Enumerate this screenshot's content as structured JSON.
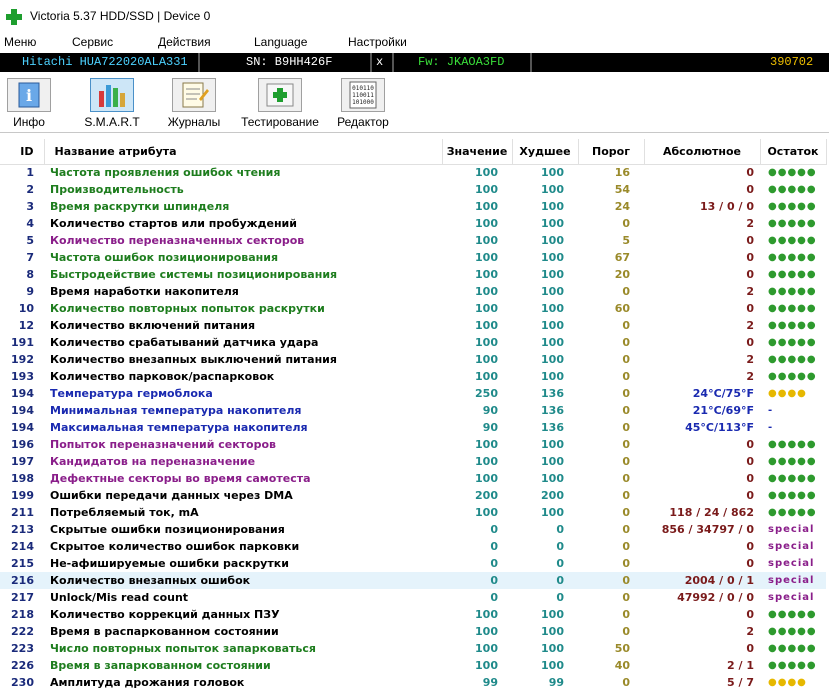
{
  "window": {
    "title": "Victoria 5.37 HDD/SSD | Device 0"
  },
  "menu": [
    "Меню",
    "Сервис",
    "Действия",
    "Language",
    "Настройки"
  ],
  "device": {
    "model": "Hitachi HUA722020ALA331",
    "sn": "SN: B9HH426F",
    "close": "x",
    "fw": "Fw: JKAOA3FD",
    "capacity": "390702"
  },
  "toolbar": [
    "Инфо",
    "S.M.A.R.T",
    "Журналы",
    "Тестирование",
    "Редактор"
  ],
  "table": {
    "headers": [
      "ID",
      "Название атрибута",
      "Значение",
      "Худшее",
      "Порог",
      "Абсолютное",
      "Остаток"
    ],
    "rows": [
      {
        "id": "1",
        "name": "Частота проявления ошибок чтения",
        "value": "100",
        "worst": "100",
        "threshold": "16",
        "abs": "0",
        "rem": "●●●●●",
        "color": "green",
        "absColor": "dark",
        "remColor": "green"
      },
      {
        "id": "2",
        "name": "Производительность",
        "value": "100",
        "worst": "100",
        "threshold": "54",
        "abs": "0",
        "rem": "●●●●●",
        "color": "green",
        "absColor": "dark",
        "remColor": "green"
      },
      {
        "id": "3",
        "name": "Время раскрутки шпинделя",
        "value": "100",
        "worst": "100",
        "threshold": "24",
        "abs": "13 / 0 / 0",
        "rem": "●●●●●",
        "color": "green",
        "absColor": "dark",
        "remColor": "green"
      },
      {
        "id": "4",
        "name": "Количество стартов или пробуждений",
        "value": "100",
        "worst": "100",
        "threshold": "0",
        "abs": "2",
        "rem": "●●●●●",
        "color": "black",
        "absColor": "dark",
        "remColor": "green"
      },
      {
        "id": "5",
        "name": "Количество переназначенных секторов",
        "value": "100",
        "worst": "100",
        "threshold": "5",
        "abs": "0",
        "rem": "●●●●●",
        "color": "purple",
        "absColor": "dark",
        "remColor": "green"
      },
      {
        "id": "7",
        "name": "Частота ошибок позиционирования",
        "value": "100",
        "worst": "100",
        "threshold": "67",
        "abs": "0",
        "rem": "●●●●●",
        "color": "green",
        "absColor": "dark",
        "remColor": "green"
      },
      {
        "id": "8",
        "name": "Быстродействие системы позиционирования",
        "value": "100",
        "worst": "100",
        "threshold": "20",
        "abs": "0",
        "rem": "●●●●●",
        "color": "green",
        "absColor": "dark",
        "remColor": "green"
      },
      {
        "id": "9",
        "name": "Время наработки накопителя",
        "value": "100",
        "worst": "100",
        "threshold": "0",
        "abs": "2",
        "rem": "●●●●●",
        "color": "black",
        "absColor": "dark",
        "remColor": "green"
      },
      {
        "id": "10",
        "name": "Количество повторных попыток раскрутки",
        "value": "100",
        "worst": "100",
        "threshold": "60",
        "abs": "0",
        "rem": "●●●●●",
        "color": "green",
        "absColor": "dark",
        "remColor": "green"
      },
      {
        "id": "12",
        "name": "Количество включений питания",
        "value": "100",
        "worst": "100",
        "threshold": "0",
        "abs": "2",
        "rem": "●●●●●",
        "color": "black",
        "absColor": "dark",
        "remColor": "green"
      },
      {
        "id": "191",
        "name": "Количество срабатываний датчика удара",
        "value": "100",
        "worst": "100",
        "threshold": "0",
        "abs": "0",
        "rem": "●●●●●",
        "color": "black",
        "absColor": "dark",
        "remColor": "green"
      },
      {
        "id": "192",
        "name": "Количество внезапных выключений питания",
        "value": "100",
        "worst": "100",
        "threshold": "0",
        "abs": "2",
        "rem": "●●●●●",
        "color": "black",
        "absColor": "dark",
        "remColor": "green"
      },
      {
        "id": "193",
        "name": "Количество парковок/распарковок",
        "value": "100",
        "worst": "100",
        "threshold": "0",
        "abs": "2",
        "rem": "●●●●●",
        "color": "black",
        "absColor": "dark",
        "remColor": "green"
      },
      {
        "id": "194",
        "name": "Температура гермоблока",
        "value": "250",
        "worst": "136",
        "threshold": "0",
        "abs": "24°C/75°F",
        "rem": "●●●●",
        "color": "blue",
        "absColor": "blue",
        "remColor": "yellow"
      },
      {
        "id": "194",
        "name": "Минимальная температура накопителя",
        "value": "90",
        "worst": "136",
        "threshold": "0",
        "abs": "21°C/69°F",
        "rem": "-",
        "color": "blue",
        "absColor": "blue",
        "remColor": "dash"
      },
      {
        "id": "194",
        "name": "Максимальная температура накопителя",
        "value": "90",
        "worst": "136",
        "threshold": "0",
        "abs": "45°C/113°F",
        "rem": "-",
        "color": "blue",
        "absColor": "blue",
        "remColor": "dash"
      },
      {
        "id": "196",
        "name": "Попыток переназначений секторов",
        "value": "100",
        "worst": "100",
        "threshold": "0",
        "abs": "0",
        "rem": "●●●●●",
        "color": "purple",
        "absColor": "dark",
        "remColor": "green"
      },
      {
        "id": "197",
        "name": "Кандидатов на переназначение",
        "value": "100",
        "worst": "100",
        "threshold": "0",
        "abs": "0",
        "rem": "●●●●●",
        "color": "purple",
        "absColor": "dark",
        "remColor": "green"
      },
      {
        "id": "198",
        "name": "Дефектные секторы во время самотеста",
        "value": "100",
        "worst": "100",
        "threshold": "0",
        "abs": "0",
        "rem": "●●●●●",
        "color": "purple",
        "absColor": "dark",
        "remColor": "green"
      },
      {
        "id": "199",
        "name": "Ошибки передачи данных через DMA",
        "value": "200",
        "worst": "200",
        "threshold": "0",
        "abs": "0",
        "rem": "●●●●●",
        "color": "black",
        "absColor": "dark",
        "remColor": "green"
      },
      {
        "id": "211",
        "name": "Потребляемый ток, mA",
        "value": "100",
        "worst": "100",
        "threshold": "0",
        "abs": "118 / 24 / 862",
        "rem": "●●●●●",
        "color": "black",
        "absColor": "dark",
        "remColor": "green"
      },
      {
        "id": "213",
        "name": "Скрытые ошибки позиционирования",
        "value": "0",
        "worst": "0",
        "threshold": "0",
        "abs": "856 / 34797 / 0",
        "rem": "special",
        "color": "black",
        "absColor": "dark",
        "remColor": "purple"
      },
      {
        "id": "214",
        "name": "Скрытое количество ошибок парковки",
        "value": "0",
        "worst": "0",
        "threshold": "0",
        "abs": "0",
        "rem": "special",
        "color": "black",
        "absColor": "dark",
        "remColor": "purple"
      },
      {
        "id": "215",
        "name": "Не-афишируемые ошибки раскрутки",
        "value": "0",
        "worst": "0",
        "threshold": "0",
        "abs": "0",
        "rem": "special",
        "color": "black",
        "absColor": "dark",
        "remColor": "purple"
      },
      {
        "id": "216",
        "name": "Количество внезапных ошибок",
        "value": "0",
        "worst": "0",
        "threshold": "0",
        "abs": "2004 / 0 / 1",
        "rem": "special",
        "color": "black",
        "absColor": "dark",
        "remColor": "purple",
        "selected": true
      },
      {
        "id": "217",
        "name": "Unlock/Mis read count",
        "value": "0",
        "worst": "0",
        "threshold": "0",
        "abs": "47992 / 0 / 0",
        "rem": "special",
        "color": "black",
        "absColor": "dark",
        "remColor": "purple"
      },
      {
        "id": "218",
        "name": "Количество коррекций данных ПЗУ",
        "value": "100",
        "worst": "100",
        "threshold": "0",
        "abs": "0",
        "rem": "●●●●●",
        "color": "black",
        "absColor": "dark",
        "remColor": "green"
      },
      {
        "id": "222",
        "name": "Время в распаркованном состоянии",
        "value": "100",
        "worst": "100",
        "threshold": "0",
        "abs": "2",
        "rem": "●●●●●",
        "color": "black",
        "absColor": "dark",
        "remColor": "green"
      },
      {
        "id": "223",
        "name": "Число повторных попыток запарковаться",
        "value": "100",
        "worst": "100",
        "threshold": "50",
        "abs": "0",
        "rem": "●●●●●",
        "color": "green",
        "absColor": "dark",
        "remColor": "green"
      },
      {
        "id": "226",
        "name": "Время в запаркованном состоянии",
        "value": "100",
        "worst": "100",
        "threshold": "40",
        "abs": "2 / 1",
        "rem": "●●●●●",
        "color": "green",
        "absColor": "dark",
        "remColor": "green"
      },
      {
        "id": "230",
        "name": "Амплитуда дрожания головок",
        "value": "99",
        "worst": "99",
        "threshold": "0",
        "abs": "5 / 7",
        "rem": "●●●●",
        "color": "black",
        "absColor": "dark",
        "remColor": "yellow"
      }
    ]
  }
}
